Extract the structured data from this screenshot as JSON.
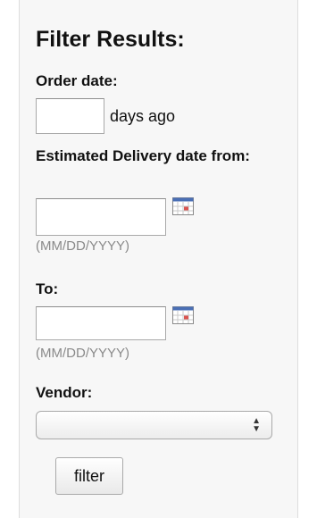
{
  "filter": {
    "title": "Filter Results:",
    "order_date": {
      "label": "Order date:",
      "value": "",
      "suffix": "days ago"
    },
    "estimated_delivery_from": {
      "label": "Estimated Delivery date from:",
      "value": "",
      "hint": "(MM/DD/YYYY)",
      "icon": "calendar-icon"
    },
    "to": {
      "label": "To:",
      "value": "",
      "hint": "(MM/DD/YYYY)",
      "icon": "calendar-icon"
    },
    "vendor": {
      "label": "Vendor:",
      "selected": ""
    },
    "submit_label": "filter"
  }
}
